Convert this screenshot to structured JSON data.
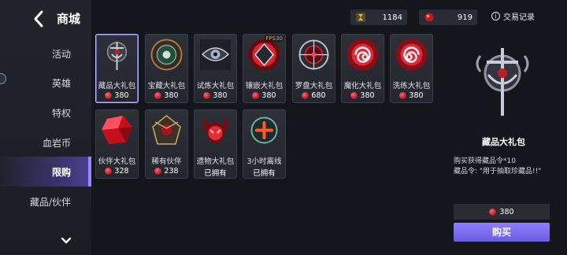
{
  "header": {
    "title": "商城",
    "history_label": "交易记录",
    "info_glyph": "i"
  },
  "currencies": [
    {
      "icon": "gold-coin-icon",
      "value": "1184"
    },
    {
      "icon": "bloodstone-gem-icon",
      "value": "919"
    }
  ],
  "sidebar": {
    "items": [
      {
        "label": "活动",
        "active": false
      },
      {
        "label": "英雄",
        "active": false
      },
      {
        "label": "特权",
        "active": false
      },
      {
        "label": "血岩币",
        "active": false
      },
      {
        "label": "限购",
        "active": true
      },
      {
        "label": "藏品/伙伴",
        "active": false
      }
    ]
  },
  "items": [
    {
      "name": "藏品大礼包",
      "price": "380",
      "icon": "trinket-emblem-icon",
      "selected": true
    },
    {
      "name": "宝藏大礼包",
      "price": "380",
      "icon": "treasure-disc-icon"
    },
    {
      "name": "试炼大礼包",
      "price": "380",
      "icon": "trial-eye-icon"
    },
    {
      "name": "镶嵌大礼包",
      "price": "380",
      "icon": "socket-gem-icon",
      "tag": "FPS30"
    },
    {
      "name": "罗盘大礼包",
      "price": "680",
      "icon": "compass-icon"
    },
    {
      "name": "魔化大礼包",
      "price": "380",
      "icon": "demonize-spiral-icon"
    },
    {
      "name": "洗练大礼包",
      "price": "380",
      "icon": "refine-spiral-icon"
    },
    {
      "name": "伙伴大礼包",
      "price": "328",
      "icon": "red-crystal-icon"
    },
    {
      "name": "稀有伙伴",
      "price": "238",
      "icon": "rare-companion-icon"
    },
    {
      "name": "遗物大礼包",
      "status": "已拥有",
      "icon": "relic-demon-icon"
    },
    {
      "name": "3小时离线",
      "status": "已拥有",
      "icon": "offline-plus-icon"
    }
  ],
  "detail": {
    "title": "藏品大礼包",
    "line1": "购买获得藏品令*10",
    "line2": "藏品令: \"用于抽取珍藏品!!\"",
    "price": "380",
    "buy_label": "购买"
  },
  "colors": {
    "accent": "#8e7dff",
    "gem": "#c81c2a",
    "active_tab": "#4a3f8e"
  }
}
